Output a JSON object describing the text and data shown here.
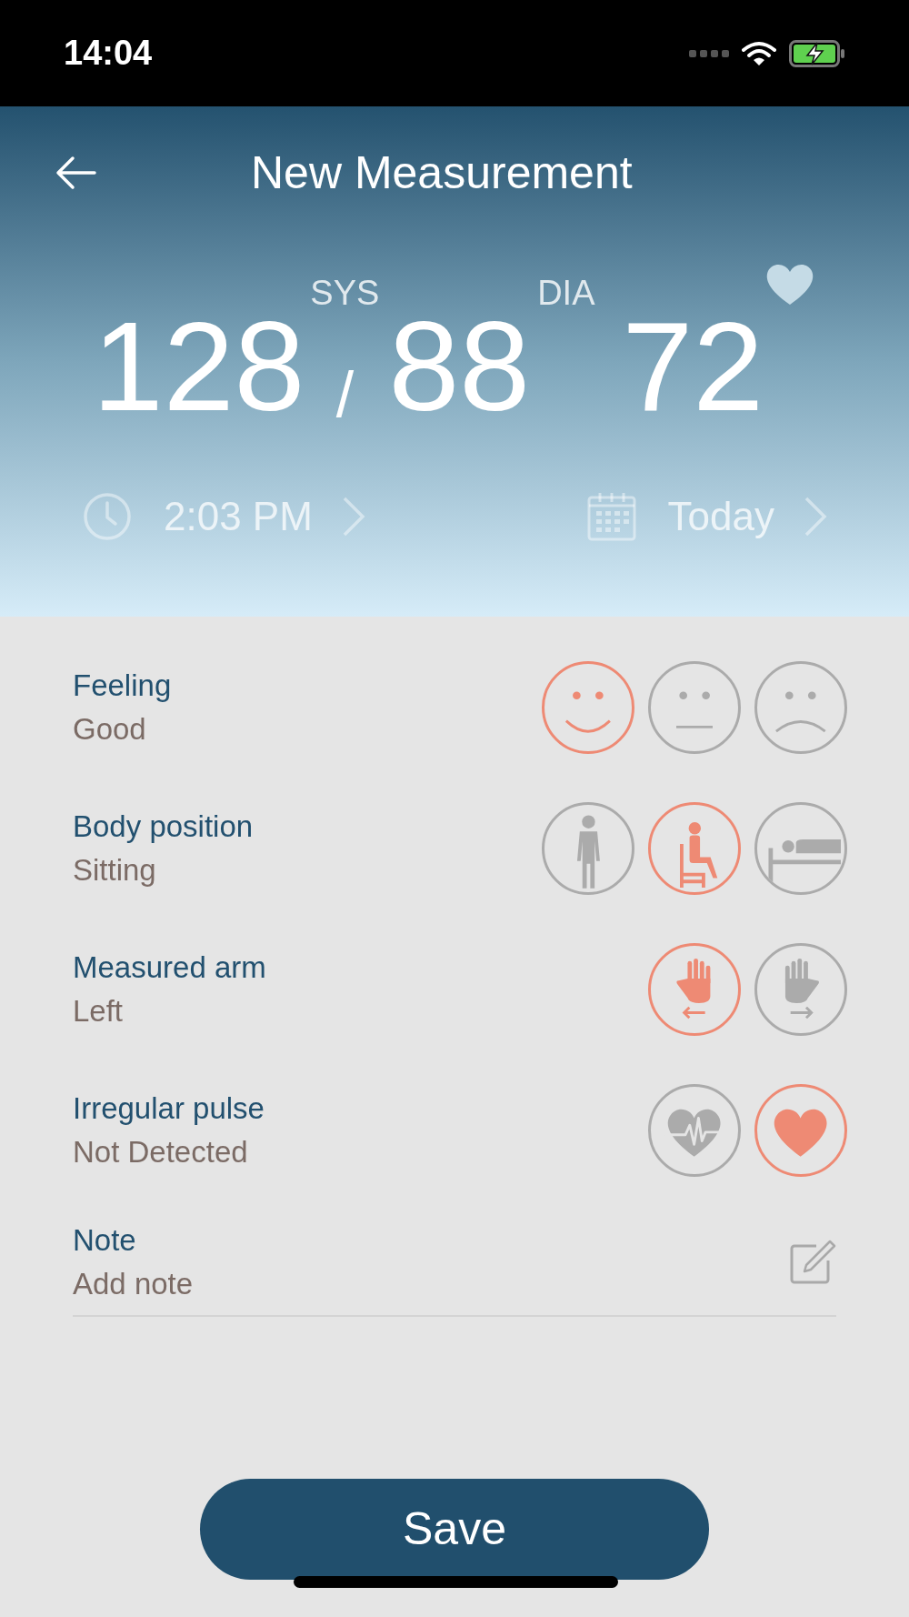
{
  "status_bar": {
    "time": "14:04"
  },
  "header": {
    "title": "New Measurement"
  },
  "reading": {
    "systolic": "128",
    "sys_label": "SYS",
    "separator": "/",
    "diastolic": "88",
    "dia_label": "DIA",
    "pulse": "72"
  },
  "time_row": {
    "time": "2:03 PM",
    "date": "Today"
  },
  "fields": [
    {
      "label": "Feeling",
      "value": "Good",
      "options": [
        {
          "kind": "smile",
          "selected": true
        },
        {
          "kind": "neutral",
          "selected": false
        },
        {
          "kind": "frown",
          "selected": false
        }
      ]
    },
    {
      "label": "Body position",
      "value": "Sitting",
      "options": [
        {
          "kind": "standing",
          "selected": false
        },
        {
          "kind": "sitting",
          "selected": true
        },
        {
          "kind": "lying",
          "selected": false
        }
      ]
    },
    {
      "label": "Measured arm",
      "value": "Left",
      "options": [
        {
          "kind": "left-hand",
          "selected": true
        },
        {
          "kind": "right-hand",
          "selected": false
        }
      ]
    },
    {
      "label": "Irregular pulse",
      "value": "Not Detected",
      "options": [
        {
          "kind": "irregular-heart",
          "selected": false
        },
        {
          "kind": "heart",
          "selected": true
        }
      ]
    }
  ],
  "note": {
    "label": "Note",
    "placeholder": "Add note"
  },
  "save_button": "Save"
}
